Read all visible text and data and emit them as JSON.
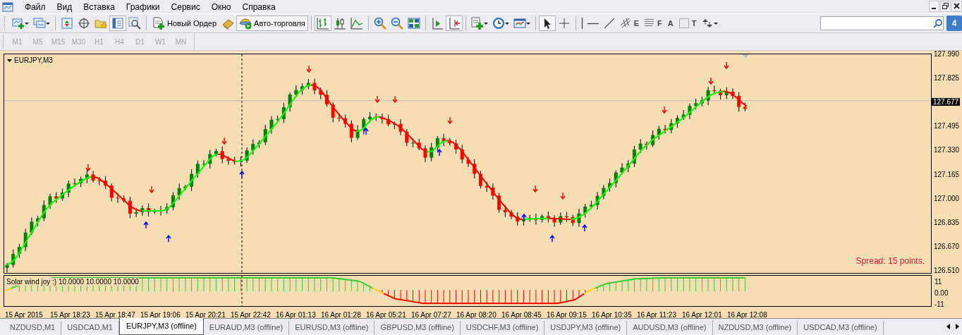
{
  "menu": {
    "items": [
      "Файл",
      "Вид",
      "Вставка",
      "Графики",
      "Сервис",
      "Окно",
      "Справка"
    ]
  },
  "toolbar": {
    "items": [
      {
        "kind": "icon",
        "dropdown": true,
        "selected": false
      },
      {
        "kind": "icon",
        "dropdown": true,
        "selected": false
      },
      {
        "kind": "separator"
      },
      {
        "kind": "icon",
        "selected": false
      },
      {
        "kind": "icon",
        "selected": false
      },
      {
        "kind": "icon",
        "selected": false
      },
      {
        "kind": "icon",
        "selected": true
      },
      {
        "kind": "icon",
        "selected": false
      },
      {
        "kind": "separator"
      },
      {
        "kind": "button",
        "label": "Новый Ордер",
        "selected": false
      },
      {
        "kind": "icon",
        "selected": false
      },
      {
        "kind": "button",
        "label": "Авто-торговля",
        "selected": true
      },
      {
        "kind": "separator"
      },
      {
        "kind": "icon",
        "selected": true
      },
      {
        "kind": "icon",
        "selected": false
      },
      {
        "kind": "icon",
        "selected": false
      },
      {
        "kind": "separator"
      },
      {
        "kind": "icon",
        "selected": false
      },
      {
        "kind": "icon",
        "selected": false
      },
      {
        "kind": "icon",
        "selected": false
      },
      {
        "kind": "separator"
      },
      {
        "kind": "icon",
        "selected": false
      },
      {
        "kind": "icon",
        "selected": true
      },
      {
        "kind": "separator"
      },
      {
        "kind": "icon",
        "dropdown": true,
        "selected": false
      },
      {
        "kind": "icon",
        "dropdown": true,
        "selected": false
      },
      {
        "kind": "icon",
        "dropdown": true,
        "selected": false
      },
      {
        "kind": "separator"
      },
      {
        "kind": "icon",
        "selected": true
      },
      {
        "kind": "icon",
        "selected": false
      },
      {
        "kind": "separator"
      },
      {
        "kind": "icon",
        "selected": false
      },
      {
        "kind": "icon",
        "selected": false
      },
      {
        "kind": "icon",
        "selected": false
      },
      {
        "kind": "icon",
        "glyph": "E",
        "selected": false
      },
      {
        "kind": "icon",
        "glyph": "F",
        "selected": false
      },
      {
        "kind": "icon",
        "glyph": "A",
        "selected": false
      },
      {
        "kind": "icon",
        "glyph": "T",
        "selected": false
      },
      {
        "kind": "icon",
        "dropdown": true,
        "selected": false
      }
    ],
    "notifications": "4"
  },
  "timeframes": [
    {
      "label": "M1",
      "disabled": true
    },
    {
      "label": "M5",
      "disabled": true
    },
    {
      "label": "M15",
      "disabled": true
    },
    {
      "label": "M30",
      "disabled": true
    },
    {
      "label": "H1",
      "disabled": true
    },
    {
      "label": "H4",
      "disabled": true
    },
    {
      "label": "D1",
      "disabled": true
    },
    {
      "label": "W1",
      "disabled": true
    },
    {
      "label": "MN",
      "disabled": true
    }
  ],
  "chart": {
    "title": "EURJPY,M3",
    "price_axis": [
      "127.990",
      "127.825",
      "127.495",
      "127.330",
      "127.165",
      "127.000",
      "126.835",
      "126.670",
      "126.510"
    ],
    "current_price": "127.677",
    "spread": "Spread: 15 points.",
    "indicator": {
      "label": "Solar wind joy :) 10.0000 10.0000 10.0000",
      "axis": [
        "11",
        "0.00",
        "-11"
      ]
    },
    "time_axis": [
      "15 Apr 2015",
      "15 Apr 18:23",
      "15 Apr 18:47",
      "15 Apr 19:06",
      "15 Apr 20:21",
      "15 Apr 22:42",
      "16 Apr 01:13",
      "16 Apr 01:28",
      "16 Apr 05:21",
      "16 Apr 07:27",
      "16 Apr 08:20",
      "16 Apr 08:45",
      "16 Apr 09:15",
      "16 Apr 10:35",
      "16 Apr 11:23",
      "16 Apr 12:01",
      "16 Apr 12:08"
    ]
  },
  "tabs": [
    {
      "label": "NZDUSD,M1",
      "selected": false
    },
    {
      "label": "USDCAD,M1",
      "selected": false
    },
    {
      "label": "EURJPY,M3 (offline)",
      "selected": true
    },
    {
      "label": "EURAUD,M3 (offline)",
      "selected": false
    },
    {
      "label": "EURUSD,M3 (offline)",
      "selected": false
    },
    {
      "label": "GBPUSD,M3 (offline)",
      "selected": false
    },
    {
      "label": "USDCHF,M3 (offline)",
      "selected": false
    },
    {
      "label": "USDJPY,M3 (offline)",
      "selected": false
    },
    {
      "label": "AUDUSD,M3 (offline)",
      "selected": false
    },
    {
      "label": "NZDUSD,M3 (offline)",
      "selected": false
    },
    {
      "label": "USDCAD,M3 (offline)",
      "selected": false
    }
  ]
}
